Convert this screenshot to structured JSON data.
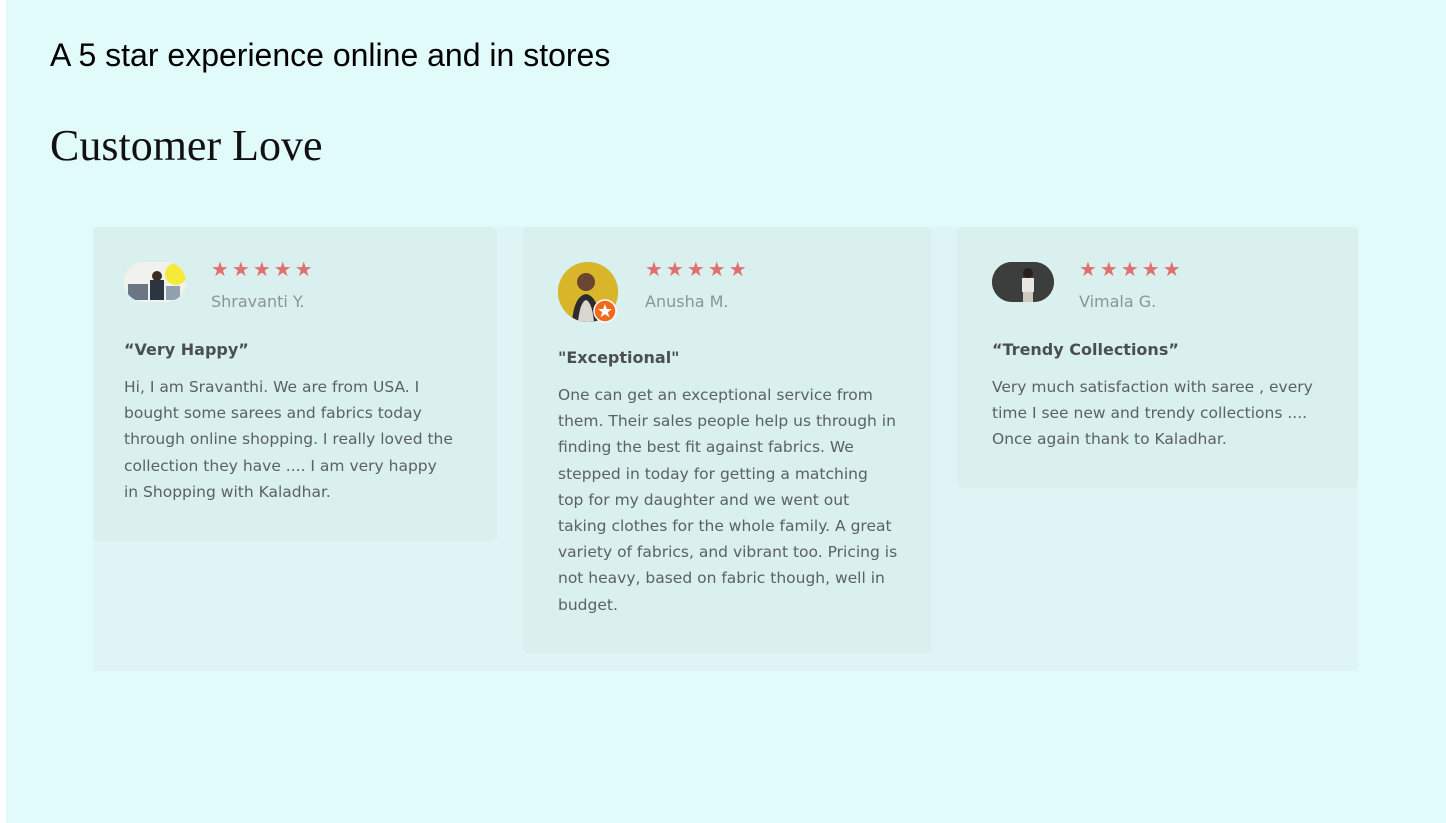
{
  "header": {
    "tagline": "A 5 star experience online and in stores",
    "section_title": "Customer Love"
  },
  "reviews": [
    {
      "rating": 5,
      "stars": "★★★★★",
      "author": "Shravanti Y.",
      "title": "“Very Happy”",
      "body": "Hi, I am Sravanthi. We are from USA. I bought some sarees and fabrics today through online shopping. I really loved the collection they have .... I am very happy in Shopping with Kaladhar."
    },
    {
      "rating": 5,
      "stars": "★★★★★",
      "author": "Anusha M.",
      "title": "\"Exceptional\"",
      "body": "One can get an exceptional service from them. Their sales people help us through in finding the best fit against fabrics. We stepped in today for getting a matching top for my daughter and we went out taking clothes for the whole family. A great variety of fabrics, and vibrant too. Pricing is not heavy, based on fabric though, well in budget."
    },
    {
      "rating": 5,
      "stars": "★★★★★",
      "author": "Vimala G.",
      "title": "“Trendy Collections”",
      "body": "Very much satisfaction with saree , every time I see new and trendy collections .... Once again thank to Kaladhar."
    }
  ],
  "colors": {
    "page_background": "#e1fafa",
    "panel_background": "#dff5f5",
    "card_background": "#daf0ee",
    "star_color": "#e07070",
    "author_color": "#8a9595",
    "title_color": "#4a4f4f",
    "body_color": "#5a6262"
  }
}
